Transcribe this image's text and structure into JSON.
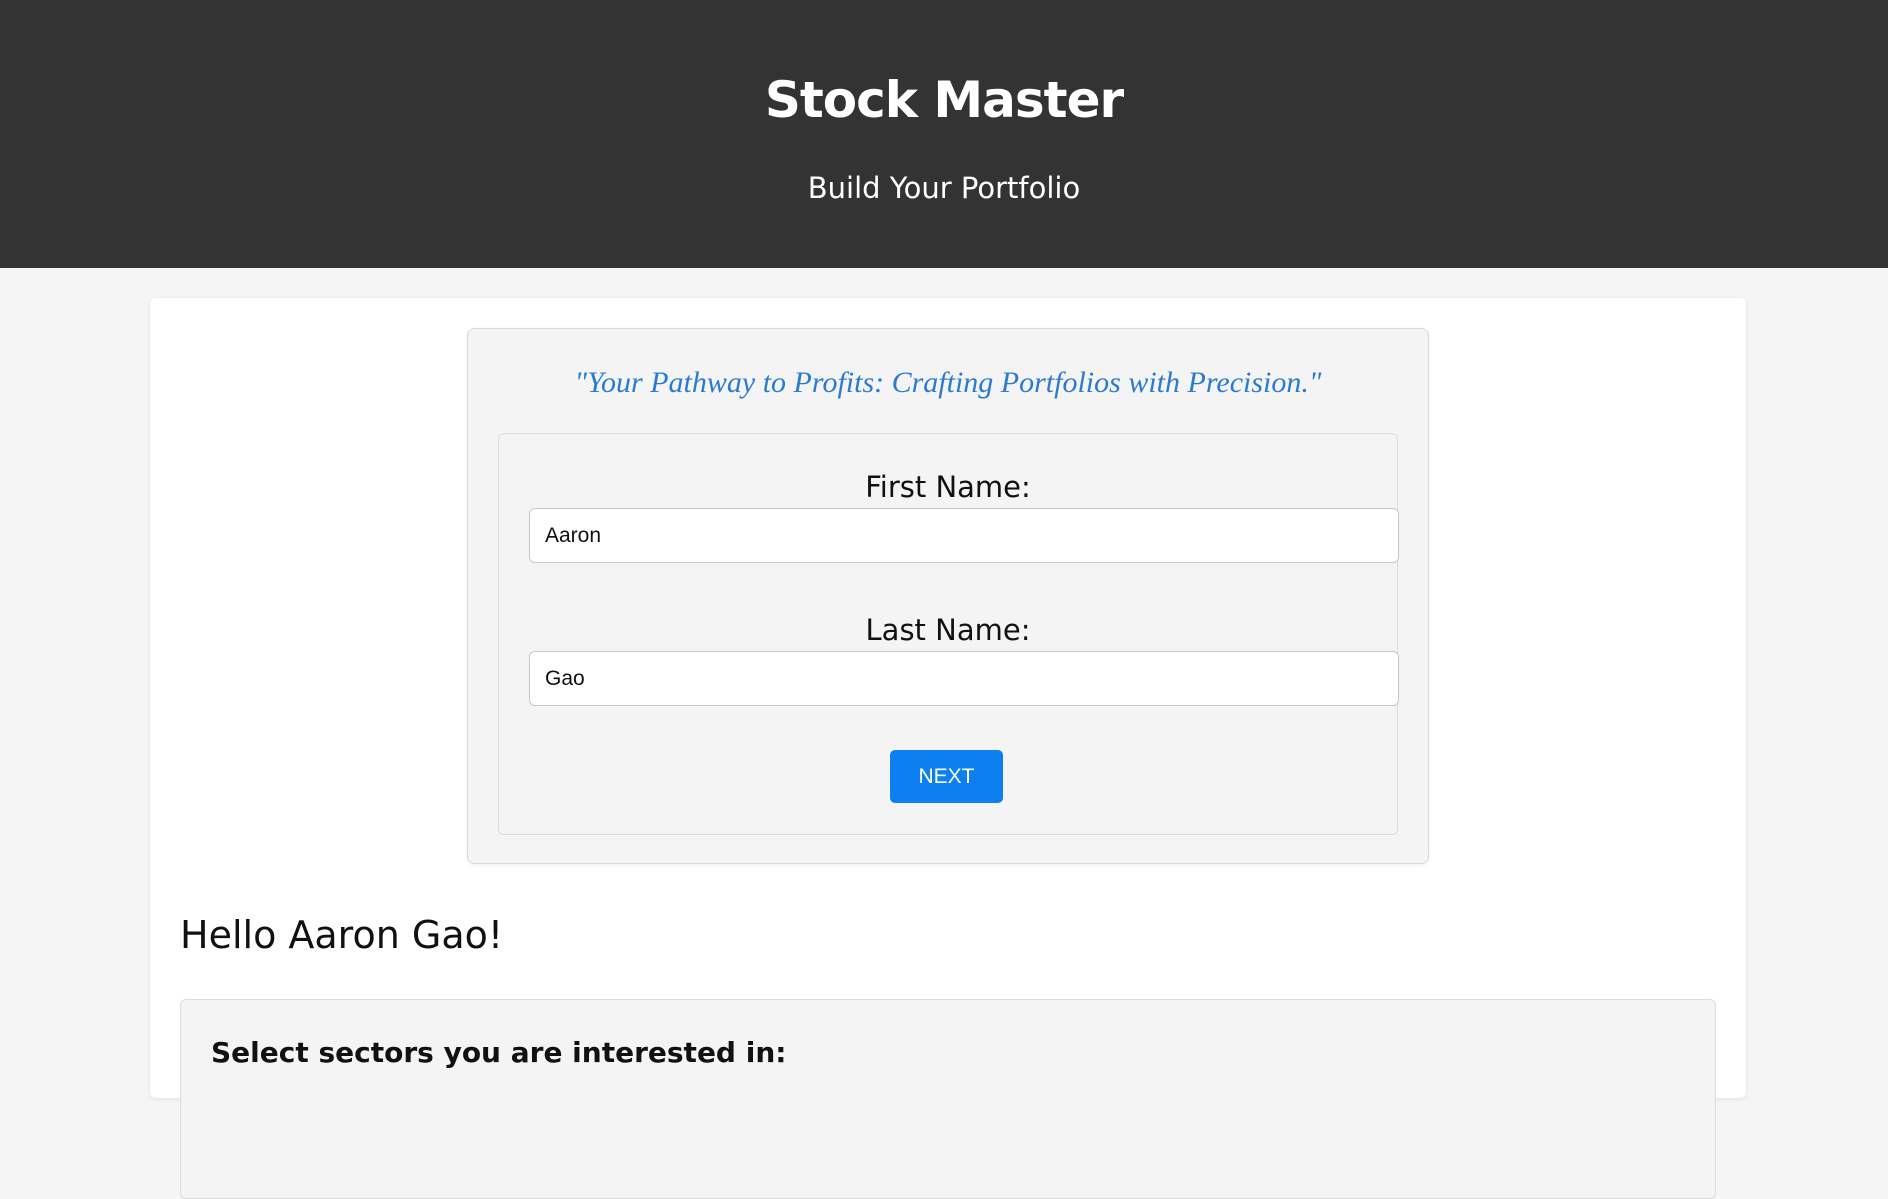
{
  "header": {
    "title": "Stock Master",
    "subtitle": "Build Your Portfolio"
  },
  "form": {
    "tagline": "\"Your Pathway to Profits: Crafting Portfolios with Precision.\"",
    "first_name_label": "First Name:",
    "first_name_value": "Aaron",
    "last_name_label": "Last Name:",
    "last_name_value": "Gao",
    "next_label": "NEXT"
  },
  "greeting": "Hello Aaron Gao!",
  "sectors": {
    "heading": "Select sectors you are interested in:"
  },
  "colors": {
    "header_bg": "#333333",
    "tagline": "#2b7bd0",
    "button": "#0d7ff0"
  }
}
